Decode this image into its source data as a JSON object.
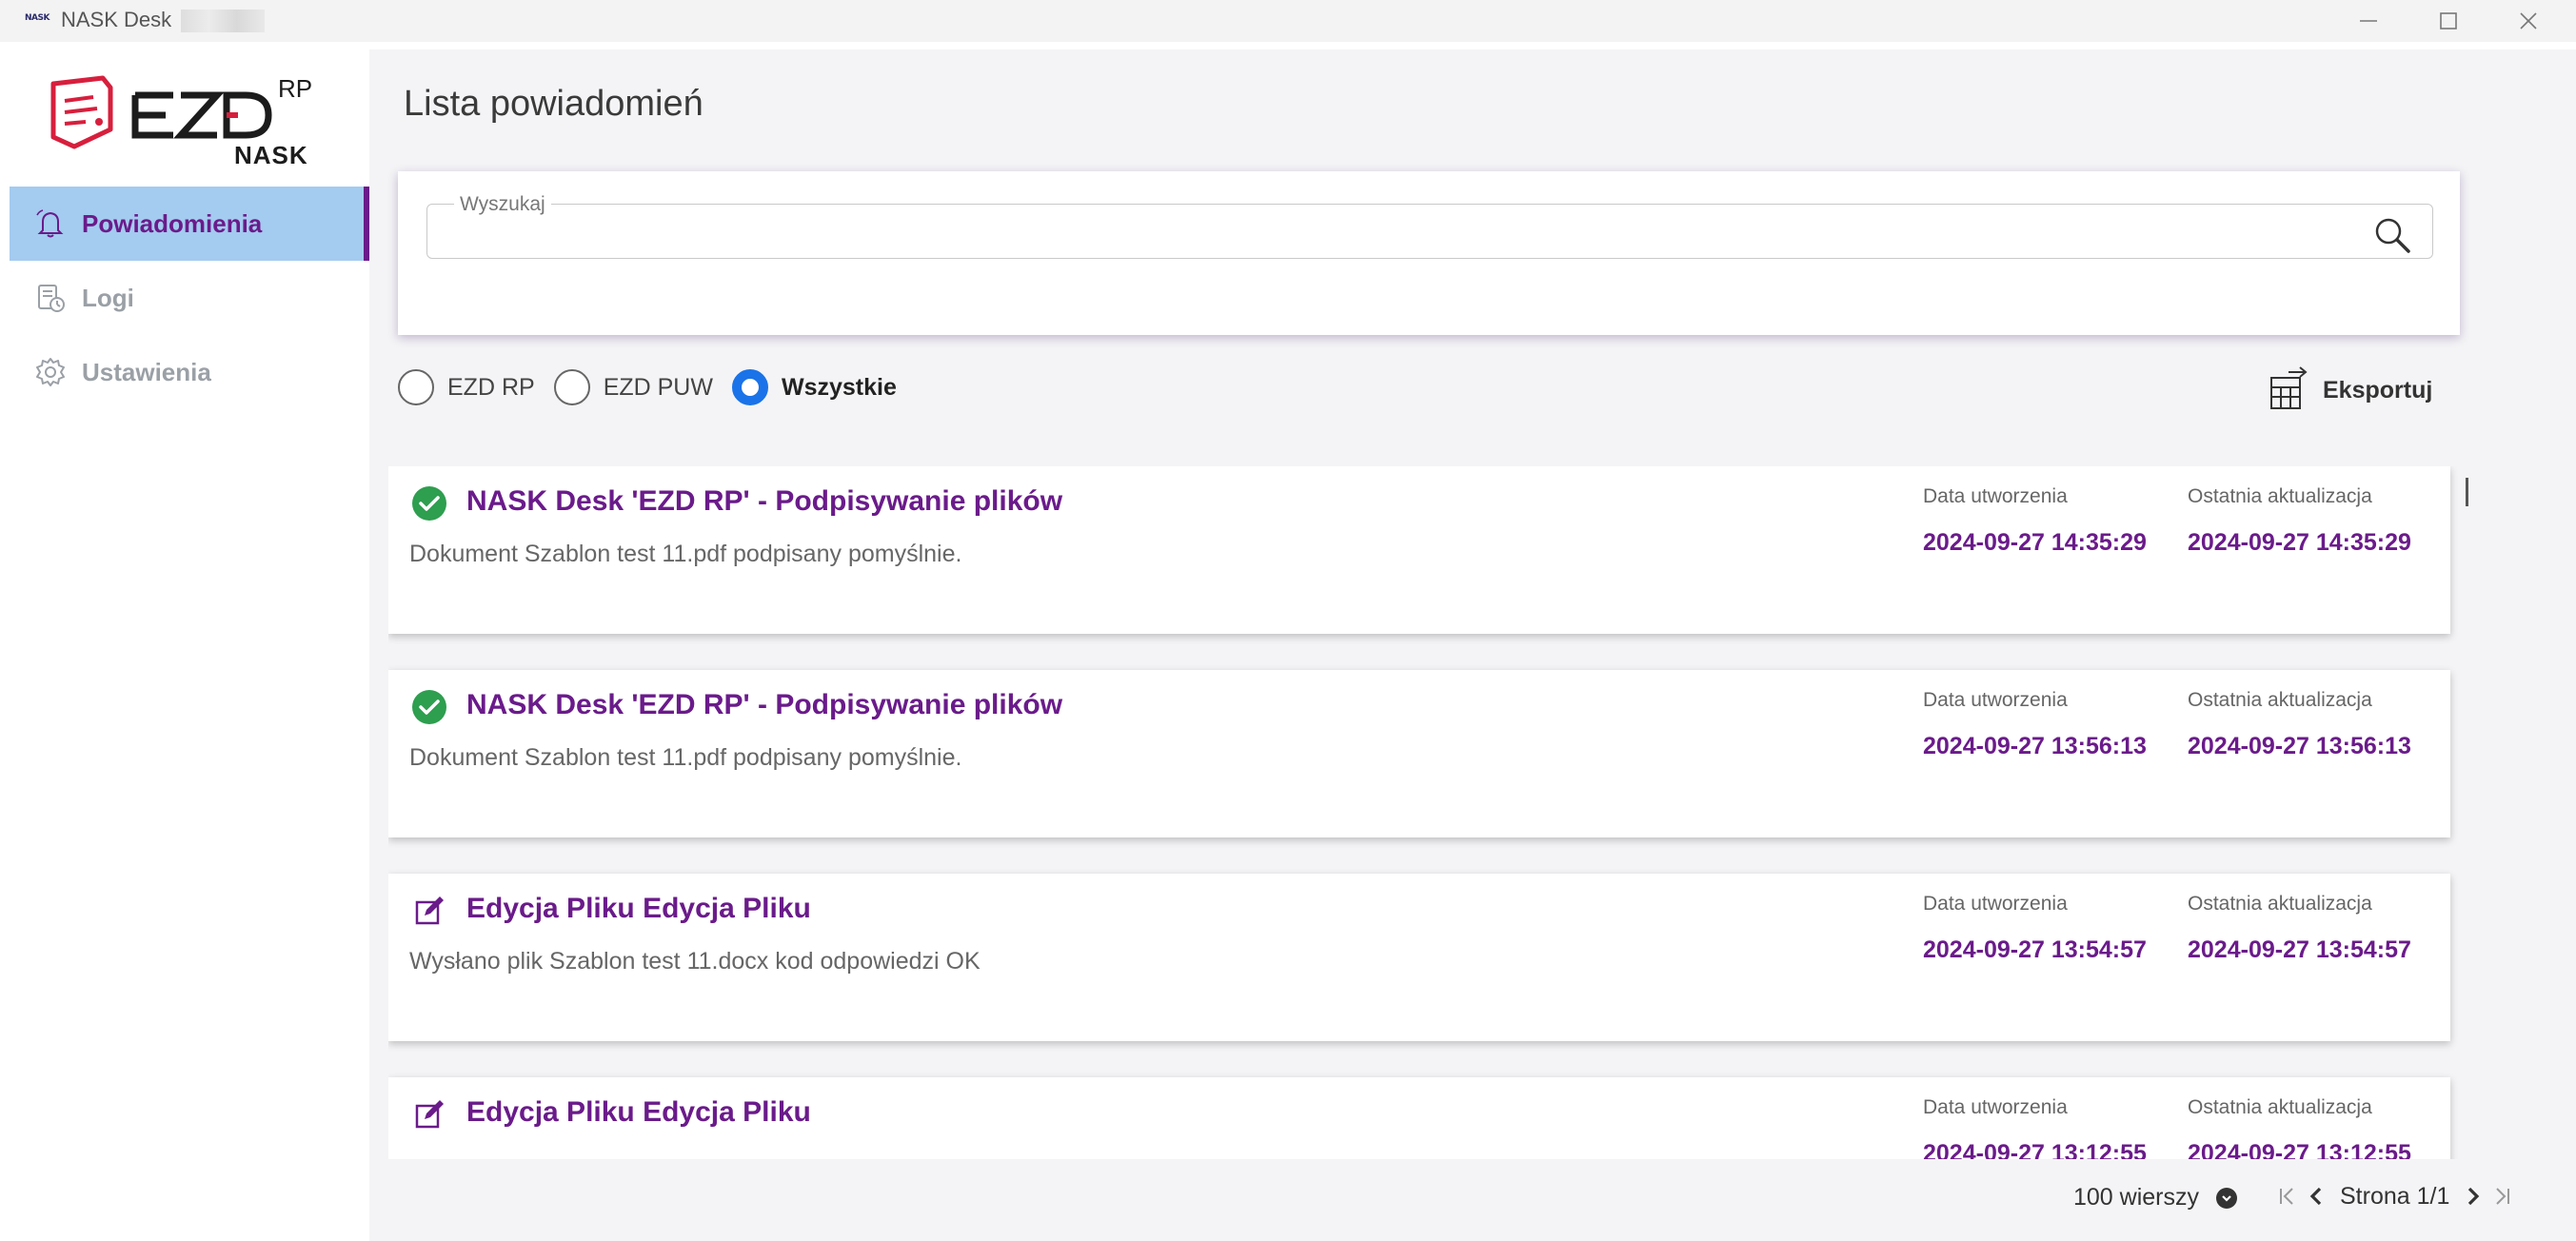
{
  "window": {
    "app_icon_text": "NASK",
    "title": "NASK Desk"
  },
  "sidebar": {
    "logo_text": "EZD",
    "logo_superscript": "RP",
    "logo_subtitle": "NASK",
    "items": [
      {
        "label": "Powiadomienia",
        "icon": "bell-icon",
        "active": true
      },
      {
        "label": "Logi",
        "icon": "log-file-icon",
        "active": false
      },
      {
        "label": "Ustawienia",
        "icon": "gear-icon",
        "active": false
      }
    ]
  },
  "main": {
    "title": "Lista powiadomień",
    "search": {
      "legend": "Wyszukaj",
      "value": "",
      "placeholder": ""
    },
    "filters": [
      {
        "label": "EZD RP",
        "checked": false
      },
      {
        "label": "EZD PUW",
        "checked": false
      },
      {
        "label": "Wszystkie",
        "checked": true
      }
    ],
    "export_label": "Eksportuj",
    "notifications": [
      {
        "icon": "check-circle-icon",
        "title": "NASK Desk 'EZD RP' - Podpisywanie plików",
        "description": "Dokument Szablon test 11.pdf podpisany pomyślnie.",
        "created_label": "Data utworzenia",
        "updated_label": "Ostatnia aktualizacja",
        "created": "2024-09-27 14:35:29",
        "updated": "2024-09-27 14:35:29"
      },
      {
        "icon": "check-circle-icon",
        "title": "NASK Desk 'EZD RP' - Podpisywanie plików",
        "description": "Dokument Szablon test 11.pdf podpisany pomyślnie.",
        "created_label": "Data utworzenia",
        "updated_label": "Ostatnia aktualizacja",
        "created": "2024-09-27 13:56:13",
        "updated": "2024-09-27 13:56:13"
      },
      {
        "icon": "edit-icon",
        "title": "Edycja Pliku Edycja Pliku",
        "description": "Wysłano plik Szablon test 11.docx kod odpowiedzi OK",
        "created_label": "Data utworzenia",
        "updated_label": "Ostatnia aktualizacja",
        "created": "2024-09-27 13:54:57",
        "updated": "2024-09-27 13:54:57"
      },
      {
        "icon": "edit-icon",
        "title": "Edycja Pliku Edycja Pliku",
        "description": "",
        "created_label": "Data utworzenia",
        "updated_label": "Ostatnia aktualizacja",
        "created": "2024-09-27 13:12:55",
        "updated": "2024-09-27 13:12:55"
      }
    ],
    "pagination": {
      "rows_label": "100 wierszy",
      "page_label": "Strona 1/1"
    }
  },
  "colors": {
    "accent_purple": "#6a1b8a",
    "active_nav_bg": "#a4cbf0",
    "radio_blue": "#1a73e8",
    "success_green": "#2e9e4f",
    "logo_red": "#d71f3d"
  }
}
